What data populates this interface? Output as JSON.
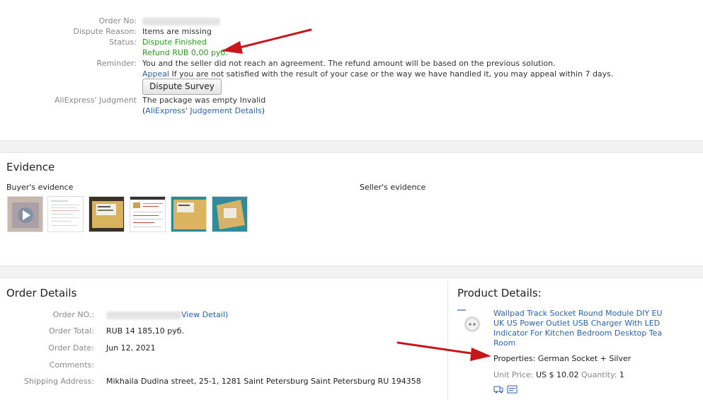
{
  "dispute": {
    "order_no_label": "Order No:",
    "reason_label": "Dispute Reason:",
    "reason_value": "Items are missing",
    "status_label": "Status:",
    "status_value": "Dispute Finished",
    "refund_value": "Refund RUB 0,00 руб.",
    "reminder_label": "Reminder:",
    "reminder_text": "You and the seller did not reach an agreement. The refund amount will be based on the previous solution.",
    "appeal_link": "Appeal",
    "appeal_text": " If you are not satisfied with the result of your case or the way we have handled it, you may appeal within 7 days.",
    "survey_button": "Dispute Survey",
    "judgment_label": "AliExpress' Judgment",
    "judgment_text": "The package was empty  Invalid",
    "judgment_paren_open": "(",
    "judgment_link": "AliExpress' Judgement Details",
    "judgment_paren_close": ")"
  },
  "evidence": {
    "title": "Evidence",
    "buyer_label": "Buyer's evidence",
    "seller_label": "Seller's evidence"
  },
  "order_details": {
    "title": "Order Details",
    "order_no_label": "Order NO.:",
    "view_detail_link": "View Detail)",
    "total_label": "Order Total:",
    "total_value": "RUB 14 185,10 руб.",
    "date_label": "Order Date:",
    "date_value": "Jun 12, 2021",
    "comments_label": "Comments:",
    "comments_value": "",
    "shipping_label": "Shipping Address:",
    "shipping_value": "Mikhaila Dudina street, 25-1, 1281 Saint Petersburg Saint Petersburg RU 194358"
  },
  "product_details": {
    "title": "Product Details:",
    "product_link": "Wallpad Track Socket Round Module DIY EU UK US Power Outlet USB Charger With LED Indicator For Kitchen Bedroom Desktop Tea Room",
    "properties_label": "Properties: ",
    "properties_value": "German Socket + Silver",
    "unit_price_label": "Unit Price: ",
    "unit_price_value": "US $ 10.02",
    "quantity_label": " Quantity: ",
    "quantity_value": "1"
  },
  "colors": {
    "link": "#2a63b7",
    "status_green": "#2a9a1e",
    "annotation_arrow": "#c8161d"
  }
}
